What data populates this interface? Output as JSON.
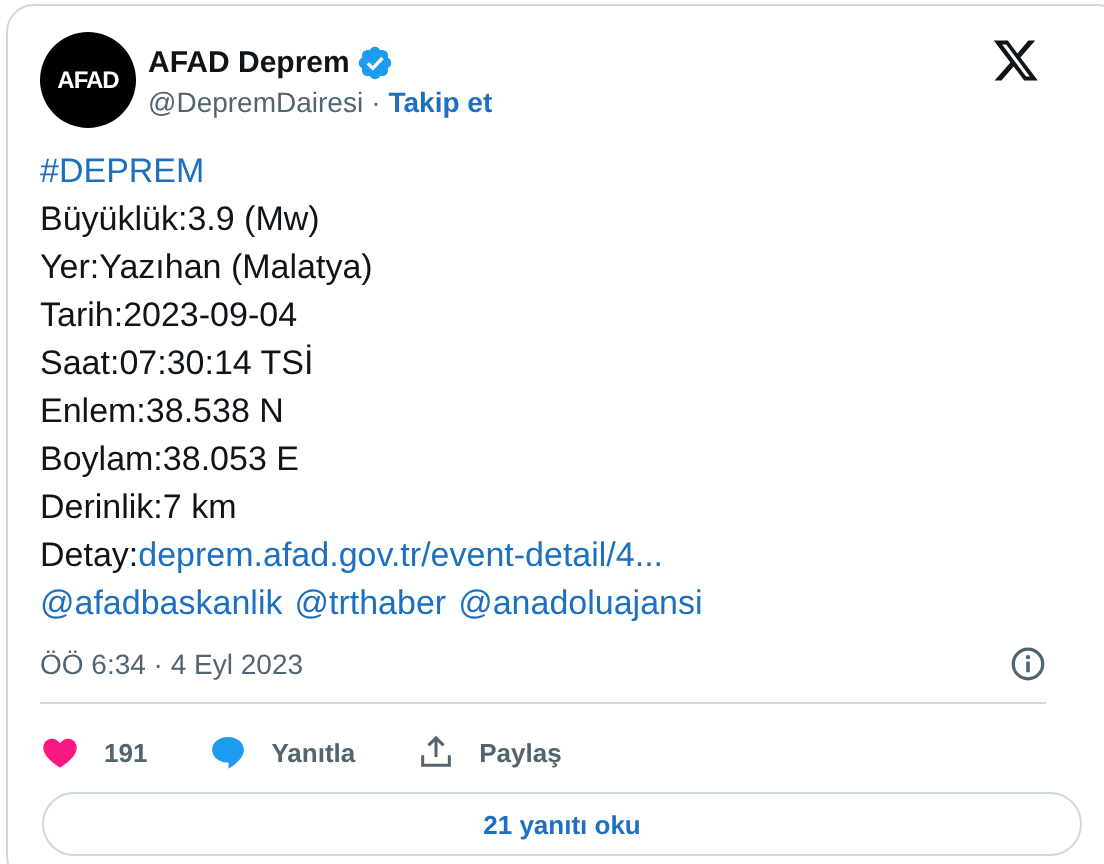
{
  "author": {
    "avatar_text": "AFAD",
    "name": "AFAD Deprem",
    "verified": true,
    "handle": "@DepremDairesi",
    "separator": "·",
    "follow": "Takip et"
  },
  "tweet": {
    "hashtag": "#DEPREM",
    "lines": [
      "Büyüklük:3.9 (Mw)",
      "Yer:Yazıhan (Malatya)",
      "Tarih:2023-09-04",
      "Saat:07:30:14 TSİ",
      "Enlem:38.538 N",
      "Boylam:38.053 E",
      "Derinlik:7 km"
    ],
    "detail": {
      "label": "Detay:",
      "link": "deprem.afad.gov.tr/event-detail/4..."
    },
    "mentions": [
      "@afadbaskanlik",
      "@trthaber",
      "@anadoluajansi"
    ],
    "timestamp": "ÖÖ 6:34 · 4 Eyl 2023"
  },
  "actions": [
    {
      "kind": "like",
      "label": "191"
    },
    {
      "kind": "reply",
      "label": "Yanıtla"
    },
    {
      "kind": "share",
      "label": "Paylaş"
    }
  ],
  "read_replies": "21 yanıtı oku"
}
